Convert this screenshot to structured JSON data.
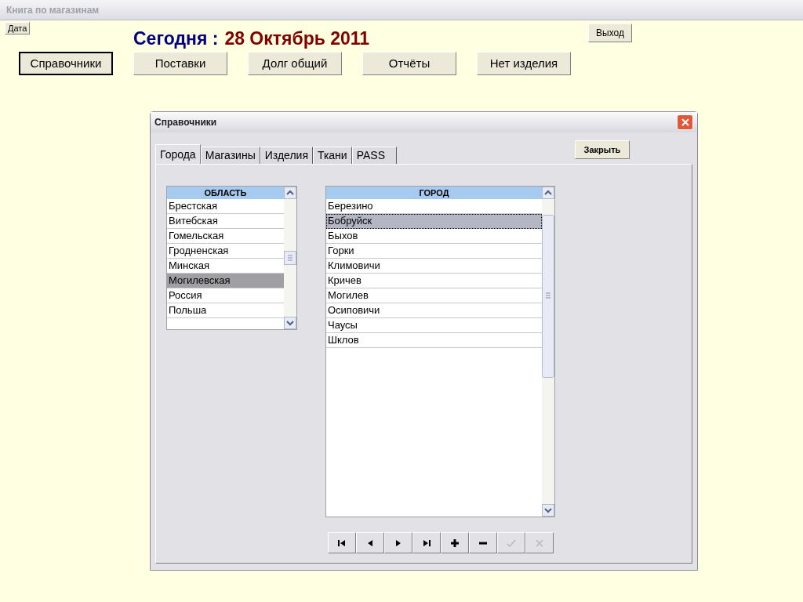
{
  "window": {
    "title": "Книга по магазинам"
  },
  "date_button": "Дата",
  "today": {
    "label": "Сегодня :",
    "date": "28 Октябрь 2011"
  },
  "exit_button": "Выход",
  "menu": [
    {
      "label": "Справочники",
      "selected": true
    },
    {
      "label": "Поставки",
      "selected": false
    },
    {
      "label": "Долг общий",
      "selected": false
    },
    {
      "label": "Отчёты",
      "selected": false
    },
    {
      "label": "Нет изделия",
      "selected": false
    }
  ],
  "dialog": {
    "title": "Справочники",
    "close_button": "Закрыть",
    "tabs": [
      {
        "label": "Города",
        "selected": true
      },
      {
        "label": "Магазины",
        "selected": false
      },
      {
        "label": "Изделия",
        "selected": false
      },
      {
        "label": "Ткани",
        "selected": false
      },
      {
        "label": "PASS",
        "selected": false
      }
    ],
    "regions": {
      "header": "ОБЛАСТЬ",
      "rows": [
        {
          "name": "Брестская",
          "selected": false
        },
        {
          "name": "Витебская",
          "selected": false
        },
        {
          "name": "Гомельская",
          "selected": false
        },
        {
          "name": "Гродненская",
          "selected": false
        },
        {
          "name": "Минская",
          "selected": false
        },
        {
          "name": "Могилевская",
          "selected": true
        },
        {
          "name": "Россия",
          "selected": false
        },
        {
          "name": "Польша",
          "selected": false
        }
      ]
    },
    "cities": {
      "header": "ГОРОД",
      "rows": [
        {
          "name": "Березино",
          "selected": false
        },
        {
          "name": "Бобруйск",
          "selected": true
        },
        {
          "name": "Быхов",
          "selected": false
        },
        {
          "name": "Горки",
          "selected": false
        },
        {
          "name": "Климовичи",
          "selected": false
        },
        {
          "name": "Кричев",
          "selected": false
        },
        {
          "name": "Могилев",
          "selected": false
        },
        {
          "name": "Осиповичи",
          "selected": false
        },
        {
          "name": "Чаусы",
          "selected": false
        },
        {
          "name": "Шклов",
          "selected": false
        }
      ]
    },
    "navigator": [
      {
        "kind": "first",
        "disabled": false
      },
      {
        "kind": "prev",
        "disabled": false
      },
      {
        "kind": "next",
        "disabled": false
      },
      {
        "kind": "last",
        "disabled": false
      },
      {
        "kind": "add",
        "disabled": false
      },
      {
        "kind": "delete",
        "disabled": false
      },
      {
        "kind": "post",
        "disabled": true
      },
      {
        "kind": "cancel",
        "disabled": true
      }
    ]
  }
}
